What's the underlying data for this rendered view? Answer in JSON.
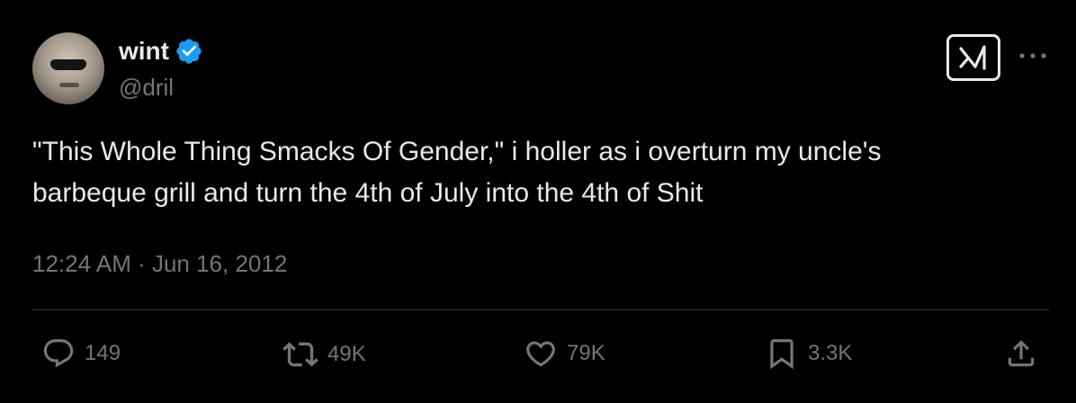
{
  "author": {
    "display_name": "wint",
    "handle": "@dril",
    "verified": true,
    "verified_color": "#1d9bf0"
  },
  "tweet": {
    "text_lines": [
      "\"This Whole Thing Smacks Of Gender,\" i holler as i overturn my uncle's",
      "barbeque grill and turn the 4th of July into the 4th of Shit"
    ],
    "timestamp": "12:24 AM · Jun 16, 2012"
  },
  "header_icons": {
    "grok": "grok-icon",
    "more": "more-icon"
  },
  "actions": {
    "replies": {
      "icon": "reply-icon",
      "count": "149"
    },
    "reposts": {
      "icon": "repost-icon",
      "count": "49K"
    },
    "likes": {
      "icon": "like-icon",
      "count": "79K"
    },
    "bookmarks": {
      "icon": "bookmark-icon",
      "count": "3.3K"
    },
    "share": {
      "icon": "share-icon"
    }
  },
  "colors": {
    "background": "#000000",
    "text_primary": "#e7e9ea",
    "text_secondary": "#71767b",
    "divider": "#2f3336"
  }
}
